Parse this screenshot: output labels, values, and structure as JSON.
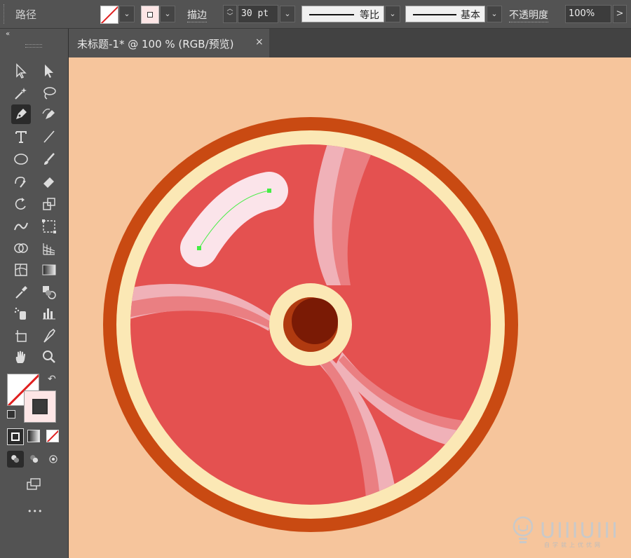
{
  "toolbar": {
    "path_label": "路径",
    "stroke_label": "描边",
    "stroke_weight": "30 pt",
    "variable_width_profile": "等比",
    "brush_definition": "基本",
    "opacity_label": "不透明度",
    "opacity_value": "100%",
    "opacity_arrow": ">",
    "dropdown_glyph": "⌄"
  },
  "tools_panel": {
    "collapse_glyph": "«",
    "more_glyph": "•••"
  },
  "document_tab": {
    "title": "未标题-1* @ 100 % (RGB/预览)",
    "close_glyph": "×"
  },
  "artwork": {
    "colors": {
      "canvas_bg": "#f6c59c",
      "outer_ring": "#c94a12",
      "cream_ring": "#fbe8b5",
      "meat": "#e45150",
      "fat_streak": "#f0b1b8",
      "fat_streak_mid": "#ea7f82",
      "highlight": "#fbe4ea",
      "bone_dark": "#7a1a05",
      "bone_mid": "#b03a10",
      "selected_path": "#44ee44"
    }
  },
  "watermark": {
    "text": "UIIIUIII",
    "subtext": "自学就上优优网"
  }
}
